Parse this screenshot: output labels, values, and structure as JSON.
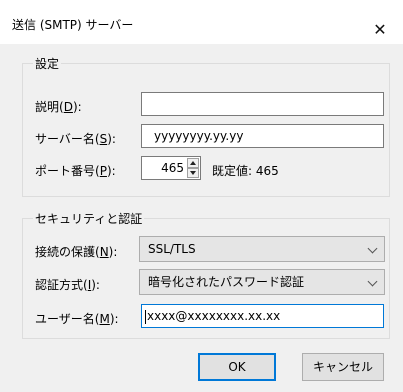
{
  "window": {
    "title": "送信 (SMTP) サーバー",
    "close_glyph": "✕"
  },
  "settings_group": {
    "label": "設定",
    "description": {
      "label": "説明(",
      "accel": "D",
      "suffix": "):",
      "value": ""
    },
    "server_name": {
      "label": "サーバー名(",
      "accel": "S",
      "suffix": "):",
      "value": "yyyyyyyy.yy.yy"
    },
    "port": {
      "label": "ポート番号(",
      "accel": "P",
      "suffix": "):",
      "value": "465",
      "default_text": "既定値: 465"
    }
  },
  "security_group": {
    "label": "セキュリティと認証",
    "connection_security": {
      "label": "接続の保護(",
      "accel": "N",
      "suffix": "):",
      "value": "SSL/TLS"
    },
    "auth_method": {
      "label": "認証方式(",
      "accel": "I",
      "suffix": "):",
      "value": "暗号化されたパスワード認証"
    },
    "username": {
      "label": "ユーザー名(",
      "accel": "M",
      "suffix": "):",
      "value": "xxxx@xxxxxxxx.xx.xx"
    }
  },
  "buttons": {
    "ok": "OK",
    "cancel": "キャンセル"
  },
  "colors": {
    "accent": "#0078d7",
    "dialog_bg": "#f0f0f0",
    "field_border": "#7a7a7a"
  }
}
